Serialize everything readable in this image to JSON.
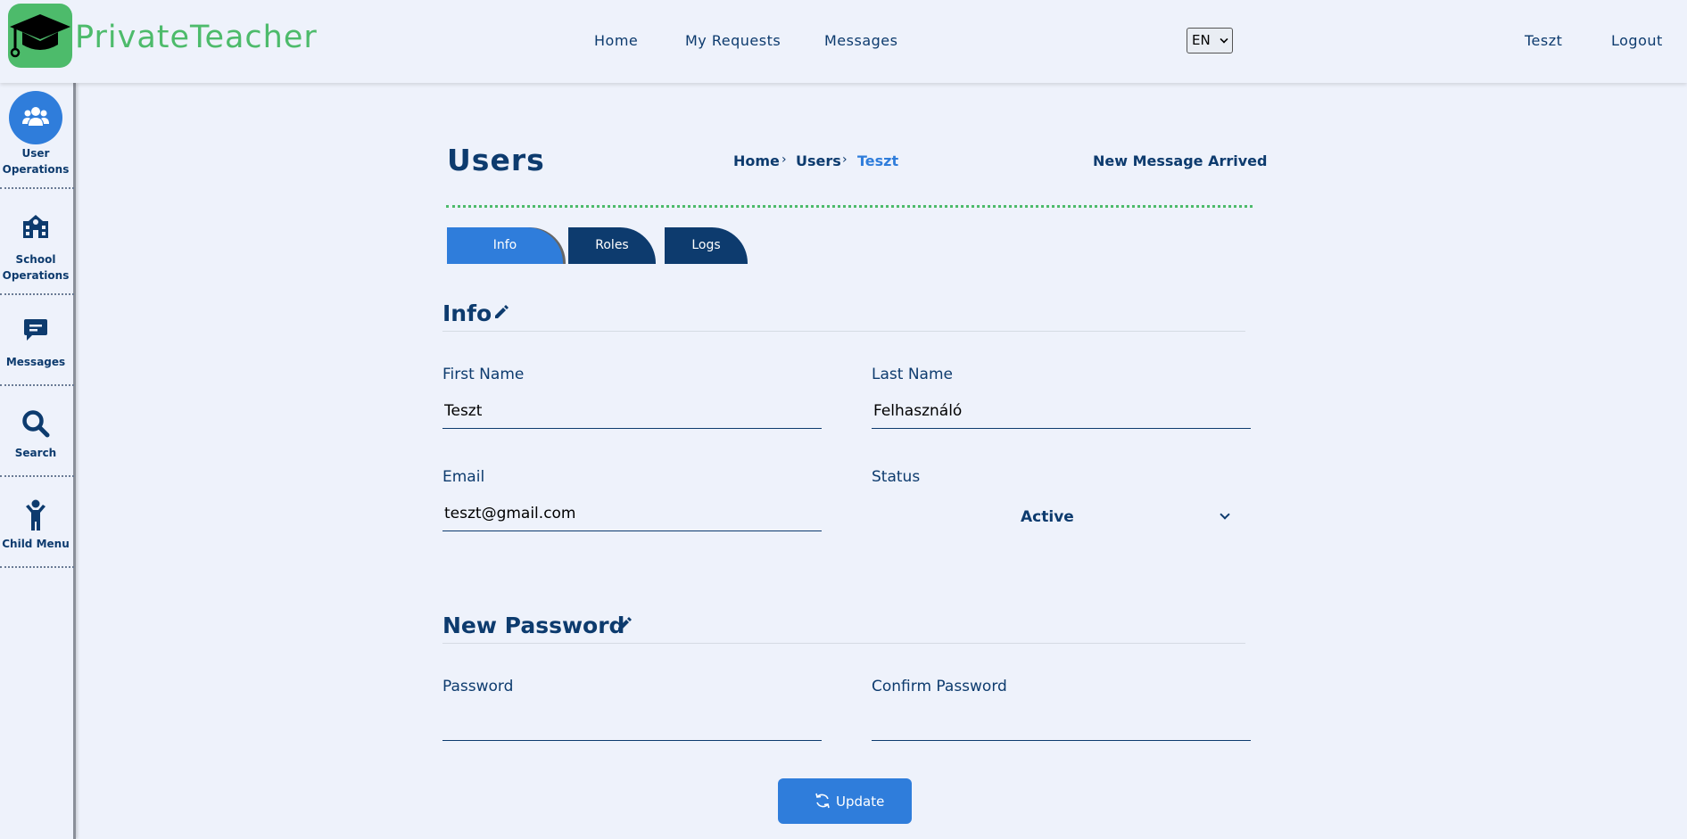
{
  "header": {
    "brand": "PrivateTeacher",
    "nav": [
      "Home",
      "My Requests",
      "Messages"
    ],
    "language": "EN",
    "user": "Teszt",
    "logout": "Logout"
  },
  "sidebar": {
    "items": [
      {
        "label": "User Operations",
        "icon": "users-icon",
        "active": true
      },
      {
        "label": "School Operations",
        "icon": "school-icon",
        "active": false
      },
      {
        "label": "Messages",
        "icon": "message-icon",
        "active": false
      },
      {
        "label": "Search",
        "icon": "search-icon",
        "active": false
      },
      {
        "label": "Child Menu",
        "icon": "child-icon",
        "active": false
      }
    ]
  },
  "page": {
    "title": "Users",
    "breadcrumb": [
      "Home",
      "Users",
      "Teszt"
    ],
    "notice": "New Message Arrived",
    "tabs": [
      "Info",
      "Roles",
      "Logs"
    ],
    "active_tab": "Info"
  },
  "info": {
    "title": "Info",
    "first_name_label": "First Name",
    "first_name": "Teszt",
    "last_name_label": "Last Name",
    "last_name": "Felhasználó",
    "email_label": "Email",
    "email": "teszt@gmail.com",
    "status_label": "Status",
    "status": "Active"
  },
  "password": {
    "title": "New Password",
    "password_label": "Password",
    "password": "",
    "confirm_label": "Confirm Password",
    "confirm": "",
    "update_label": "Update"
  },
  "colors": {
    "primary": "#2f7ddb",
    "navy": "#0d3b6e",
    "brand_green": "#4dbb6b",
    "background": "#eef2fb"
  }
}
